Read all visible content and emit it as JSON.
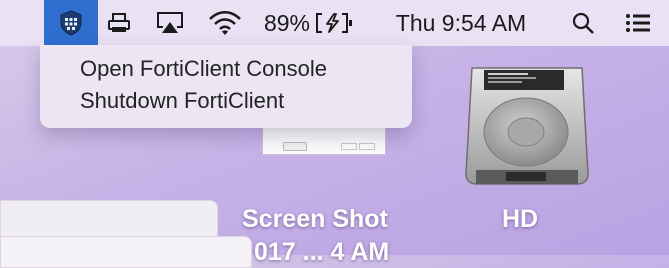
{
  "menubar": {
    "battery_percent": "89%",
    "datetime": "Thu 9:54 AM",
    "icons": [
      "forticlient-shield-icon",
      "printer-icon",
      "airplay-icon",
      "wifi-icon",
      "battery-charging-icon",
      "spotlight-search-icon",
      "notification-center-icon"
    ]
  },
  "dropdown": {
    "items": [
      {
        "label": "Open FortiClient Console"
      },
      {
        "label": "Shutdown FortiClient"
      }
    ]
  },
  "desktop": {
    "file_label_line1": "Screen Shot",
    "file_label_line2": "017 ... 4 AM",
    "drive_label": "HD"
  },
  "colors": {
    "menubar_bg": "#e9e1f4",
    "forticlient_highlight": "#2f6ecf",
    "desktop_bg": "#c7b3e6"
  }
}
